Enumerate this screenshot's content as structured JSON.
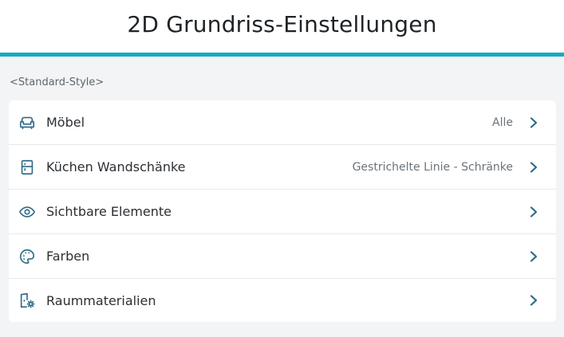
{
  "header": {
    "title": "2D Grundriss-Einstellungen"
  },
  "style_label": "<Standard-Style>",
  "colors": {
    "accent": "#16a9c4",
    "icon": "#2f6b86"
  },
  "settings": [
    {
      "label": "Möbel",
      "value": "Alle",
      "icon": "sofa-icon"
    },
    {
      "label": "Küchen Wandschänke",
      "value": "Gestrichelte Linie - Schränke",
      "icon": "cabinet-icon"
    },
    {
      "label": "Sichtbare Elemente",
      "value": "",
      "icon": "eye-icon"
    },
    {
      "label": "Farben",
      "value": "",
      "icon": "palette-icon"
    },
    {
      "label": "Raummaterialien",
      "value": "",
      "icon": "room-settings-icon"
    }
  ]
}
